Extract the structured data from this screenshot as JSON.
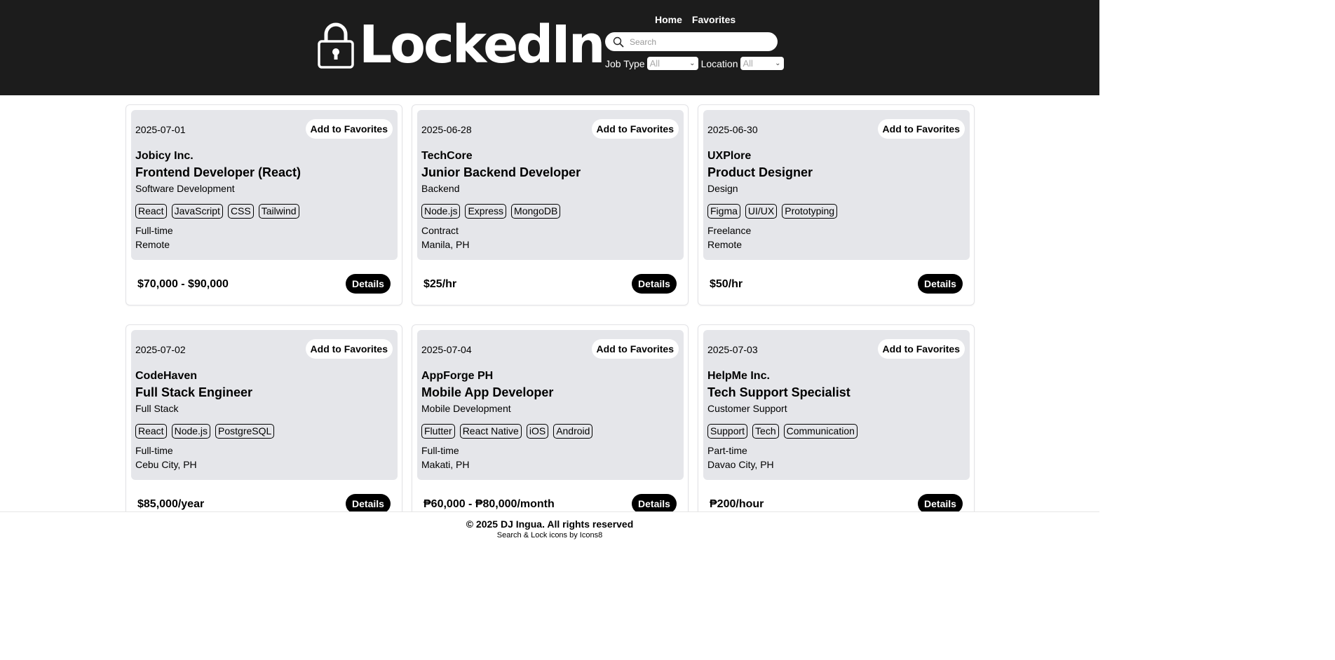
{
  "header": {
    "logo_text": "LockedIn",
    "nav": [
      "Home",
      "Favorites"
    ],
    "search_placeholder": "Search",
    "job_type_label": "Job Type",
    "job_type_value": "All",
    "location_label": "Location",
    "location_value": "All"
  },
  "jobs": [
    {
      "date": "2025-07-01",
      "fav": "Add to Favorites",
      "company": "Jobicy Inc.",
      "title": "Frontend Developer (React)",
      "category": "Software Development",
      "tags": [
        "React",
        "JavaScript",
        "CSS",
        "Tailwind"
      ],
      "type": "Full-time",
      "location": "Remote",
      "pay": "$70,000 - $90,000",
      "details": "Details"
    },
    {
      "date": "2025-06-28",
      "fav": "Add to Favorites",
      "company": "TechCore",
      "title": "Junior Backend Developer",
      "category": "Backend",
      "tags": [
        "Node.js",
        "Express",
        "MongoDB"
      ],
      "type": "Contract",
      "location": "Manila, PH",
      "pay": "$25/hr",
      "details": "Details"
    },
    {
      "date": "2025-06-30",
      "fav": "Add to Favorites",
      "company": "UXPlore",
      "title": "Product Designer",
      "category": "Design",
      "tags": [
        "Figma",
        "UI/UX",
        "Prototyping"
      ],
      "type": "Freelance",
      "location": "Remote",
      "pay": "$50/hr",
      "details": "Details"
    },
    {
      "date": "2025-07-02",
      "fav": "Add to Favorites",
      "company": "CodeHaven",
      "title": "Full Stack Engineer",
      "category": "Full Stack",
      "tags": [
        "React",
        "Node.js",
        "PostgreSQL"
      ],
      "type": "Full-time",
      "location": "Cebu City, PH",
      "pay": "$85,000/year",
      "details": "Details"
    },
    {
      "date": "2025-07-04",
      "fav": "Add to Favorites",
      "company": "AppForge PH",
      "title": "Mobile App Developer",
      "category": "Mobile Development",
      "tags": [
        "Flutter",
        "React Native",
        "iOS",
        "Android"
      ],
      "type": "Full-time",
      "location": "Makati, PH",
      "pay": "₱60,000 - ₱80,000/month",
      "details": "Details"
    },
    {
      "date": "2025-07-03",
      "fav": "Add to Favorites",
      "company": "HelpMe Inc.",
      "title": "Tech Support Specialist",
      "category": "Customer Support",
      "tags": [
        "Support",
        "Tech",
        "Communication"
      ],
      "type": "Part-time",
      "location": "Davao City, PH",
      "pay": "₱200/hour",
      "details": "Details"
    }
  ],
  "footer": {
    "copyright": "© 2025 DJ Ingua. All rights reserved",
    "credit": "Search & Lock icons by Icons8"
  }
}
